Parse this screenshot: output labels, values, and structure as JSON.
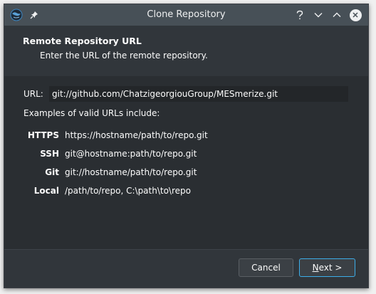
{
  "window": {
    "title": "Clone Repository",
    "controls": [
      "help-icon",
      "minimize-icon",
      "maximize-icon",
      "close-icon"
    ]
  },
  "header": {
    "title": "Remote Repository URL",
    "subtitle": "Enter the URL of the remote repository."
  },
  "url": {
    "label": "URL:",
    "value": "git://github.com/ChatzigeorgiouGroup/MESmerize.git"
  },
  "examples": {
    "heading": "Examples of valid URLs include:",
    "rows": [
      {
        "key": "HTTPS",
        "value": "https://hostname/path/to/repo.git"
      },
      {
        "key": "SSH",
        "value": "git@hostname:path/to/repo.git"
      },
      {
        "key": "Git",
        "value": "git://hostname/path/to/repo.git"
      },
      {
        "key": "Local",
        "value": "/path/to/repo, C:\\path\\to\\repo"
      }
    ]
  },
  "buttons": {
    "cancel": "Cancel",
    "next_mnemonic": "N",
    "next_rest": "ext >"
  },
  "colors": {
    "accent": "#3daee9",
    "window_bg": "#2a2e32",
    "titlebar_bg": "#475057"
  }
}
